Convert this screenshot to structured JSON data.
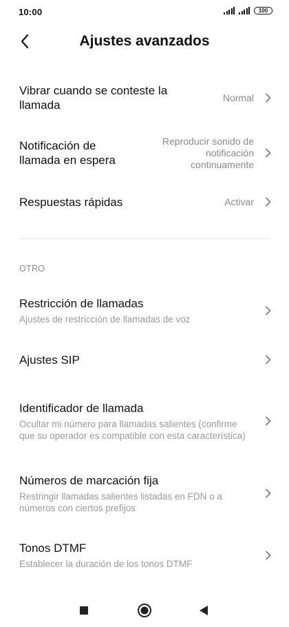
{
  "status_bar": {
    "time": "10:00",
    "battery": "100",
    "icons": [
      "signal-icon",
      "signal-icon",
      "battery-icon"
    ]
  },
  "header": {
    "back_icon": "back-arrow-icon",
    "title": "Ajustes avanzados"
  },
  "settings": [
    {
      "title": "Vibrar cuando se conteste la llamada",
      "value": "Normal"
    },
    {
      "title": "Notificación de llamada en espera",
      "value": "Reproducir sonido de notificación continuamente"
    },
    {
      "title": "Respuestas rápidas",
      "value": "Activar"
    }
  ],
  "other_section": {
    "label": "OTRO",
    "items": [
      {
        "title": "Restricción de llamadas",
        "subtitle": "Ajustes de restricción de llamadas de voz"
      },
      {
        "title": "Ajustes SIP",
        "subtitle": ""
      },
      {
        "title": "Identificador de llamada",
        "subtitle": "Ocultar mi número para llamadas salientes (confirme que su operador es compatible con esta característica)"
      },
      {
        "title": "Números de marcación fija",
        "subtitle": "Restringir llamadas salientes listadas en FDN o a números con ciertos prefijos"
      },
      {
        "title": "Tonos DTMF",
        "subtitle": "Establecer la duración de los tonos DTMF"
      }
    ]
  },
  "nav_bar": {
    "icons": [
      "recents-square-icon",
      "home-circle-icon",
      "back-triangle-icon"
    ]
  },
  "colors": {
    "text_primary": "#111111",
    "text_secondary": "#9a9a9a",
    "divider": "#e6e6e6",
    "background": "#ffffff"
  }
}
